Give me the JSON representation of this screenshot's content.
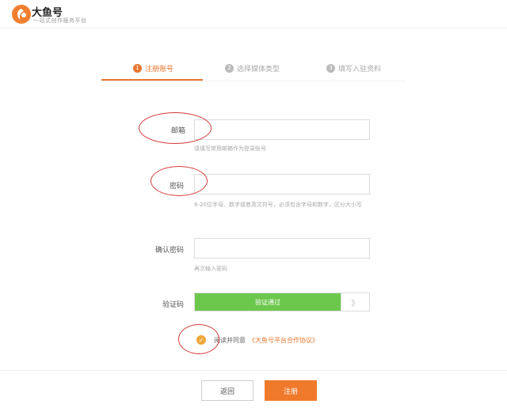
{
  "header": {
    "logo_name": "大鱼号",
    "slogan": "一站式创作服务平台"
  },
  "steps": [
    {
      "num": "1",
      "label": "注册账号"
    },
    {
      "num": "2",
      "label": "选择媒体类型"
    },
    {
      "num": "3",
      "label": "填写入驻资料"
    }
  ],
  "form": {
    "email": {
      "label": "邮箱",
      "value": "",
      "hint": "请填写常用邮箱作为登录账号"
    },
    "password": {
      "label": "密码",
      "value": "",
      "hint": "6-20位字母、数字或者英文符号，必须包含字母和数字，区分大小写"
    },
    "confirm": {
      "label": "确认密码",
      "value": "",
      "hint": "再次输入密码"
    },
    "captcha": {
      "label": "验证码",
      "status": "验证通过",
      "handle": "》"
    }
  },
  "agreement": {
    "checked": true,
    "text": "阅读并同意",
    "link": "《大鱼号平台合作协议》"
  },
  "buttons": {
    "back": "返回",
    "register": "注册"
  },
  "colors": {
    "accent": "#e8772e",
    "success": "#6cc84c",
    "annotation": "#d63a3a"
  }
}
